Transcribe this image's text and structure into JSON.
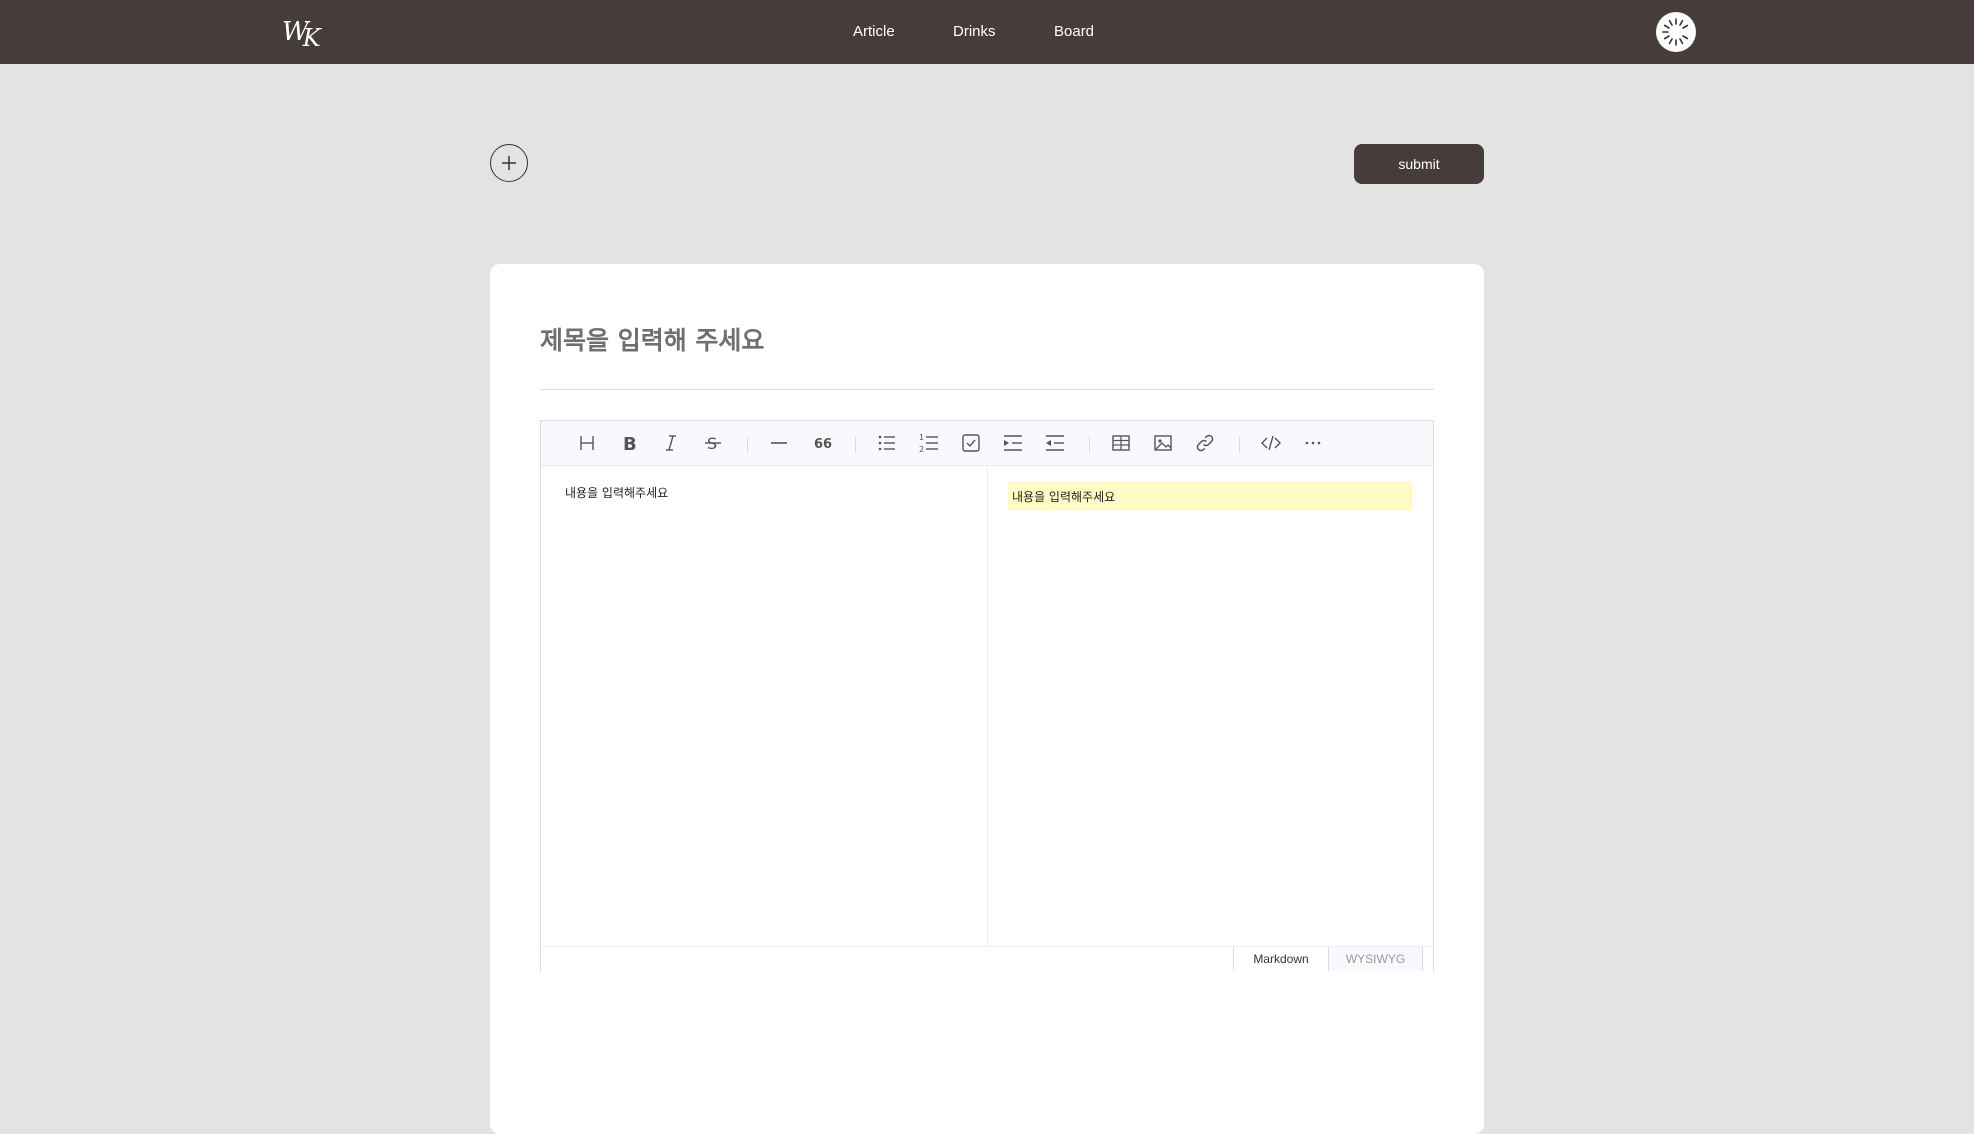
{
  "nav": {
    "logo_text_w": "W",
    "logo_text_k": "K",
    "links": [
      "Article",
      "Drinks",
      "Board"
    ]
  },
  "actions": {
    "submit_label": "submit"
  },
  "editor": {
    "title_placeholder": "제목을 입력해 주세요",
    "markdown_text": "내용을 입력해주세요",
    "preview_text": "내용을 입력해주세요",
    "modes": [
      "Markdown",
      "WYSIWYG"
    ],
    "active_mode": "Markdown",
    "toolbar_icons": [
      "heading-icon",
      "bold-icon",
      "italic-icon",
      "strike-icon",
      "hr-icon",
      "quote-icon",
      "bullet-list-icon",
      "ordered-list-icon",
      "task-list-icon",
      "indent-icon",
      "outdent-icon",
      "table-icon",
      "image-icon",
      "link-icon",
      "code-icon",
      "more-icon"
    ]
  },
  "colors": {
    "nav_bg": "#463d3b",
    "page_bg": "#e3e3e3",
    "preview_highlight": "#fdfbc3"
  }
}
